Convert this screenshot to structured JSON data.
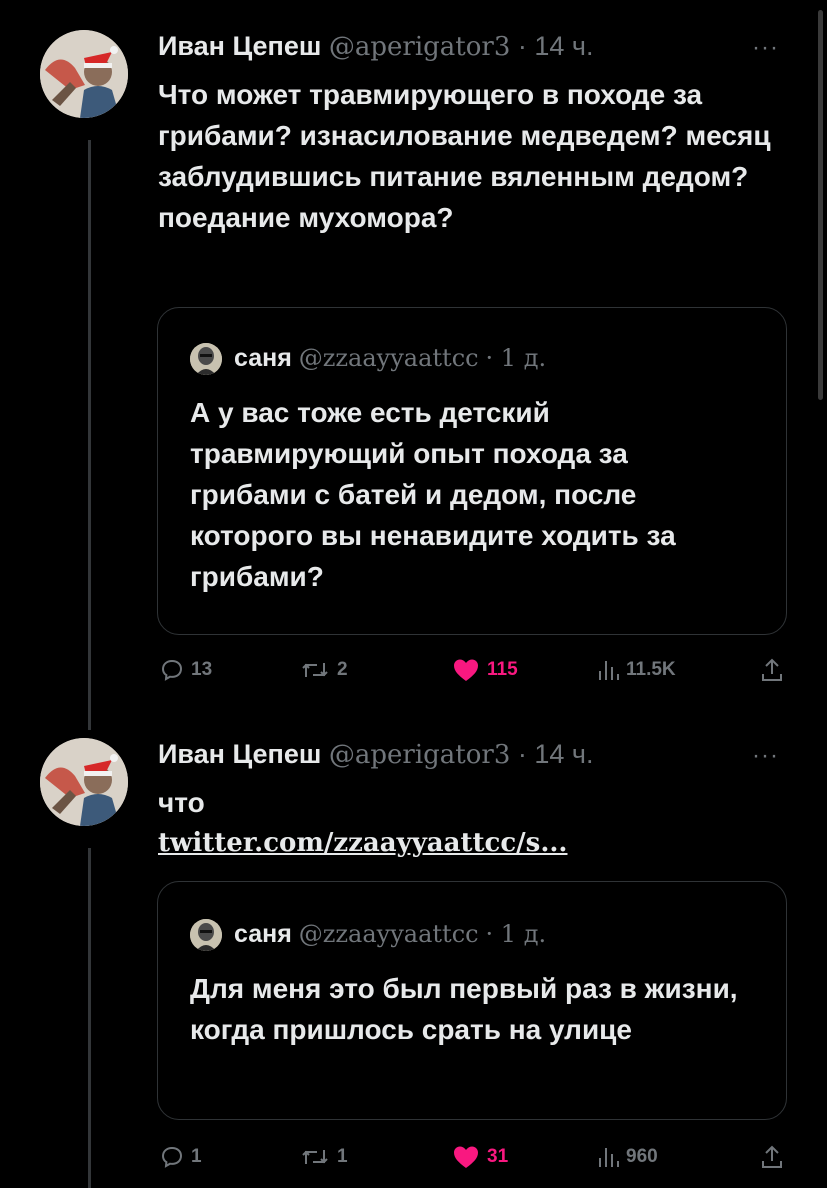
{
  "tweets": [
    {
      "author_name": "Иван Цепеш",
      "author_handle": "@aperigator3",
      "time": "· 14 ч.",
      "more": "···",
      "text": "Что может травмирующего в походе за грибами? изнасилование медведем? месяц заблудившись питание вяленным дедом? поедание мухомора?",
      "link": "",
      "quote": {
        "author_name": "саня",
        "author_handle": "@zzaayyaattcc",
        "time": "· 1 д.",
        "text": "А у вас тоже есть детский травмирующий опыт похода за грибами с батей и дедом, после которого вы ненавидите ходить за грибами?"
      },
      "stats": {
        "replies": "13",
        "retweets": "2",
        "likes": "115",
        "views": "11.5K"
      }
    },
    {
      "author_name": "Иван Цепеш",
      "author_handle": "@aperigator3",
      "time": "· 14 ч.",
      "more": "···",
      "text": "что",
      "link": "twitter.com/zzaayyaattcc/s...",
      "quote": {
        "author_name": "саня",
        "author_handle": "@zzaayyaattcc",
        "time": "· 1 д.",
        "text": "Для меня это был первый раз в жизни, когда пришлось срать на улице"
      },
      "stats": {
        "replies": "1",
        "retweets": "1",
        "likes": "31",
        "views": "960"
      }
    }
  ],
  "icons": {
    "reply": "reply-icon",
    "retweet": "retweet-icon",
    "like": "heart-icon",
    "views": "views-icon",
    "share": "share-icon"
  },
  "colors": {
    "like_active": "#f91880",
    "muted": "#71767b",
    "text": "#e7e9ea",
    "background": "#000000"
  }
}
